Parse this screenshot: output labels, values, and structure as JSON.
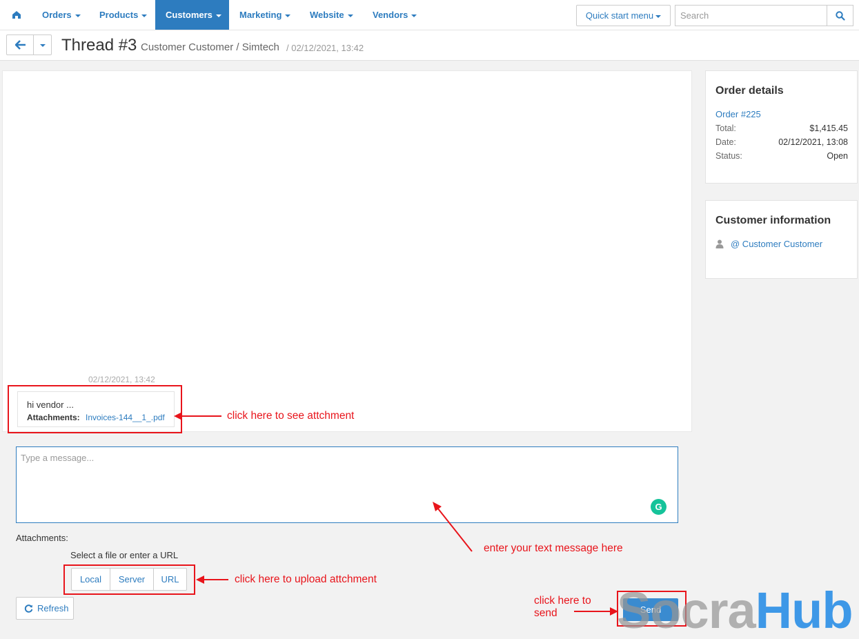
{
  "nav": {
    "items": [
      {
        "label": "Orders"
      },
      {
        "label": "Products"
      },
      {
        "label": "Customers"
      },
      {
        "label": "Marketing"
      },
      {
        "label": "Website"
      },
      {
        "label": "Vendors"
      }
    ],
    "active_item": "Customers",
    "quick_start_label": "Quick start menu",
    "search_placeholder": "Search"
  },
  "title": {
    "heading": "Thread #3",
    "subtitle": "Customer Customer / Simtech",
    "date": "/ 02/12/2021, 13:42"
  },
  "message": {
    "time": "02/12/2021, 13:42",
    "text": "hi vendor ...",
    "attachments_label": "Attachments:",
    "attachment_file": "Invoices-144__1_.pdf"
  },
  "compose": {
    "placeholder": "Type a message...",
    "attachments_label": "Attachments:",
    "file_hint": "Select a file or enter a URL",
    "source_buttons": [
      "Local",
      "Server",
      "URL"
    ],
    "refresh_label": "Refresh",
    "send_label": "Send"
  },
  "order_details": {
    "title": "Order details",
    "order_link": "Order #225",
    "rows": [
      {
        "label": "Total:",
        "value": "$1,415.45"
      },
      {
        "label": "Date:",
        "value": "02/12/2021, 13:08"
      },
      {
        "label": "Status:",
        "value": "Open"
      }
    ]
  },
  "customer_info": {
    "title": "Customer information",
    "customer_link": "@ Customer Customer"
  },
  "annotations": {
    "attachment_view": "click here to see attchment",
    "text_message": "enter your text message here",
    "upload": "click here to upload attchment",
    "send_line1": "click here to",
    "send_line2": "send"
  },
  "watermark": {
    "part1": "Socra",
    "part2": "Hub"
  },
  "colors": {
    "accent": "#2d7cbf",
    "annotation": "#e8141b",
    "background": "#f2f2f2"
  }
}
